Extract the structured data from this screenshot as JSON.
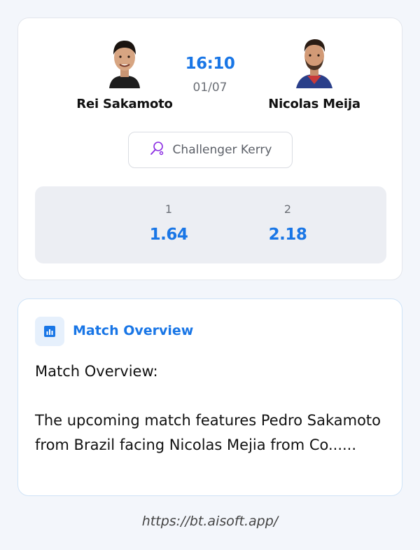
{
  "match": {
    "player1": {
      "name": "Rei Sakamoto"
    },
    "player2": {
      "name": "Nicolas Meija"
    },
    "time": "16:10",
    "date": "01/07",
    "tournament": {
      "name": "Challenger Kerry",
      "icon": "tennis-racket-icon"
    },
    "odds": [
      {
        "label": "1",
        "value": "1.64"
      },
      {
        "label": "2",
        "value": "2.18"
      }
    ]
  },
  "overview": {
    "title": "Match Overview",
    "icon": "bar-chart-icon",
    "text": "Match Overview:\n\nThe upcoming match features Pedro Sakamoto from Brazil facing Nicolas Mejia from Co......"
  },
  "footer": {
    "url": "https://bt.aisoft.app/"
  },
  "colors": {
    "accent": "#1976e6",
    "icon_purple": "#8a2be2"
  }
}
